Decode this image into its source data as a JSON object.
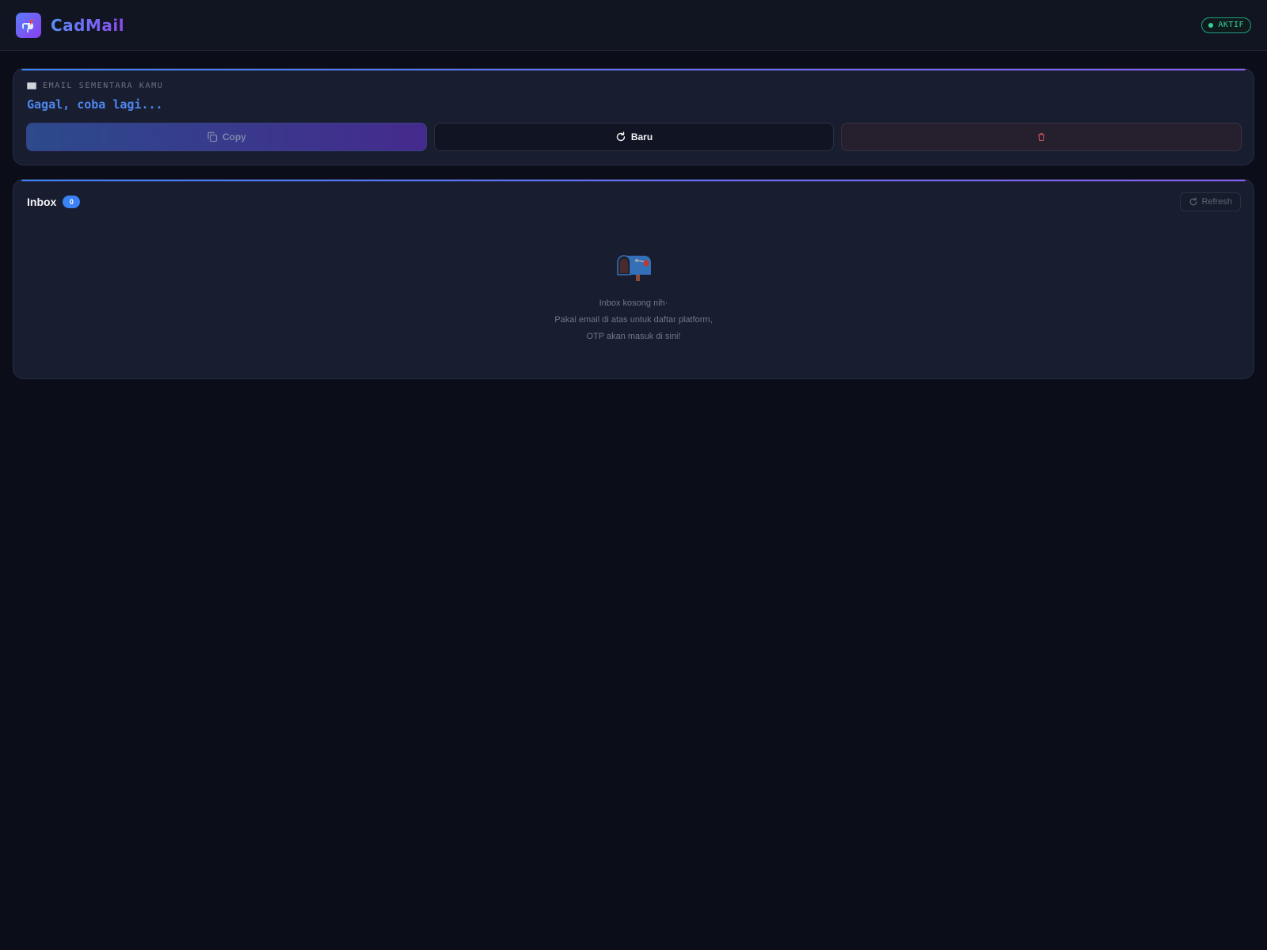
{
  "app": {
    "name": "CadMail",
    "status": "AKTIF"
  },
  "email_card": {
    "label": "EMAIL SEMENTARA KAMU",
    "value": "Gagal, coba lagi...",
    "copy_label": "Copy",
    "new_label": "Baru"
  },
  "inbox": {
    "title": "Inbox",
    "count": "0",
    "refresh_label": "Refresh",
    "empty_lines": [
      "Inbox kosong nih·",
      "Pakai email di atas untuk daftar platform,",
      "OTP akan masuk di sini!"
    ]
  },
  "colors": {
    "accent_blue": "#3b82f6",
    "accent_purple": "#8b5cf6",
    "status_green": "#34d399",
    "email_text": "#4e86ee"
  },
  "icons": [
    "mailbox-icon",
    "envelope-icon",
    "copy-icon",
    "refresh-icon",
    "trash-icon",
    "open-mailbox-icon"
  ]
}
